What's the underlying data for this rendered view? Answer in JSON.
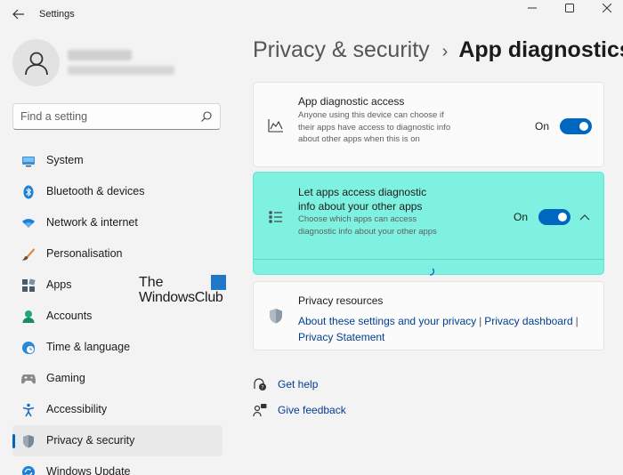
{
  "window": {
    "title": "Settings"
  },
  "sidebar": {
    "search_placeholder": "Find a setting",
    "items": [
      {
        "label": "System",
        "icon": "monitor-icon"
      },
      {
        "label": "Bluetooth & devices",
        "icon": "bluetooth-icon"
      },
      {
        "label": "Network & internet",
        "icon": "wifi-icon"
      },
      {
        "label": "Personalisation",
        "icon": "brush-icon"
      },
      {
        "label": "Apps",
        "icon": "apps-icon"
      },
      {
        "label": "Accounts",
        "icon": "person-icon"
      },
      {
        "label": "Time & language",
        "icon": "clock-globe-icon"
      },
      {
        "label": "Gaming",
        "icon": "gamepad-icon"
      },
      {
        "label": "Accessibility",
        "icon": "accessibility-icon"
      },
      {
        "label": "Privacy & security",
        "icon": "shield-icon",
        "active": true
      },
      {
        "label": "Windows Update",
        "icon": "update-icon"
      }
    ]
  },
  "watermark": {
    "line1": "The",
    "line2": "WindowsClub"
  },
  "breadcrumb": {
    "parent": "Privacy & security",
    "separator": "›",
    "current": "App diagnostics"
  },
  "settings": {
    "app_diagnostic": {
      "title": "App diagnostic access",
      "description": "Anyone using this device can choose if their apps have access to diagnostic info about other apps when this is on",
      "state": "On"
    },
    "let_apps": {
      "title": "Let apps access diagnostic info about your other apps",
      "description": "Choose which apps can access diagnostic info about your other apps",
      "state": "On"
    }
  },
  "privacy_resources": {
    "title": "Privacy resources",
    "link1": "About these settings and your privacy",
    "link2": "Privacy dashboard",
    "link3": "Privacy Statement",
    "separator": "|"
  },
  "help": {
    "get_help": "Get help",
    "give_feedback": "Give feedback"
  },
  "colors": {
    "accent": "#0067c0",
    "highlight": "#7ff1e0",
    "link": "#003e92"
  }
}
